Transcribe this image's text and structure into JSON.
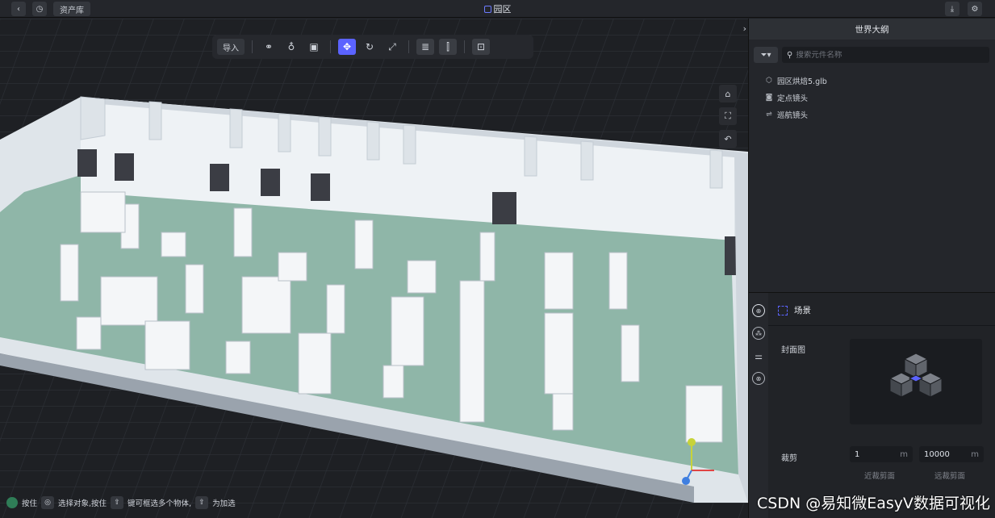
{
  "topbar": {
    "back_icon": "chevron-left-icon",
    "history_icon": "clock-icon",
    "library_label": "资产库",
    "title": "园区",
    "download_icon": "download-icon",
    "settings_icon": "gear-icon"
  },
  "toolbar": {
    "import_label": "导入",
    "tools": [
      "add-object-icon",
      "light-icon",
      "camera-icon",
      "move-icon",
      "rotate-icon",
      "scale-icon",
      "align-left-icon",
      "align-center-icon",
      "lock-icon"
    ],
    "active_tool": "move-icon"
  },
  "side_tools": [
    "view-mode-icon",
    "focus-icon",
    "undo-icon"
  ],
  "statusbar": {
    "press": "按住",
    "select_text": "选择对象,按住",
    "multi_text": "键可框选多个物体,",
    "add_text": "为加选"
  },
  "outline": {
    "title": "世界大纲",
    "search_placeholder": "搜索元件名称",
    "items": [
      {
        "icon": "model-icon",
        "label": "园区烘焙5.glb"
      },
      {
        "icon": "camera-icon",
        "label": "定点镜头"
      },
      {
        "icon": "route-icon",
        "label": "巡航镜头"
      }
    ]
  },
  "inspector": {
    "tabs": [
      "scene-icon",
      "materials-icon",
      "adjust-icon",
      "globe-icon"
    ],
    "section_title": "场景",
    "cover_label": "封面图",
    "clip_label": "裁剪",
    "near_value": "1",
    "far_value": "10000",
    "unit": "m",
    "near_caption": "近裁剪面",
    "far_caption": "远裁剪面"
  },
  "watermark": "CSDN @易知微EasyV数据可视化",
  "colors": {
    "accent": "#5b63ff",
    "floor": "#8fb6a8",
    "wall": "#e8edf2",
    "panel": "#24262b"
  }
}
